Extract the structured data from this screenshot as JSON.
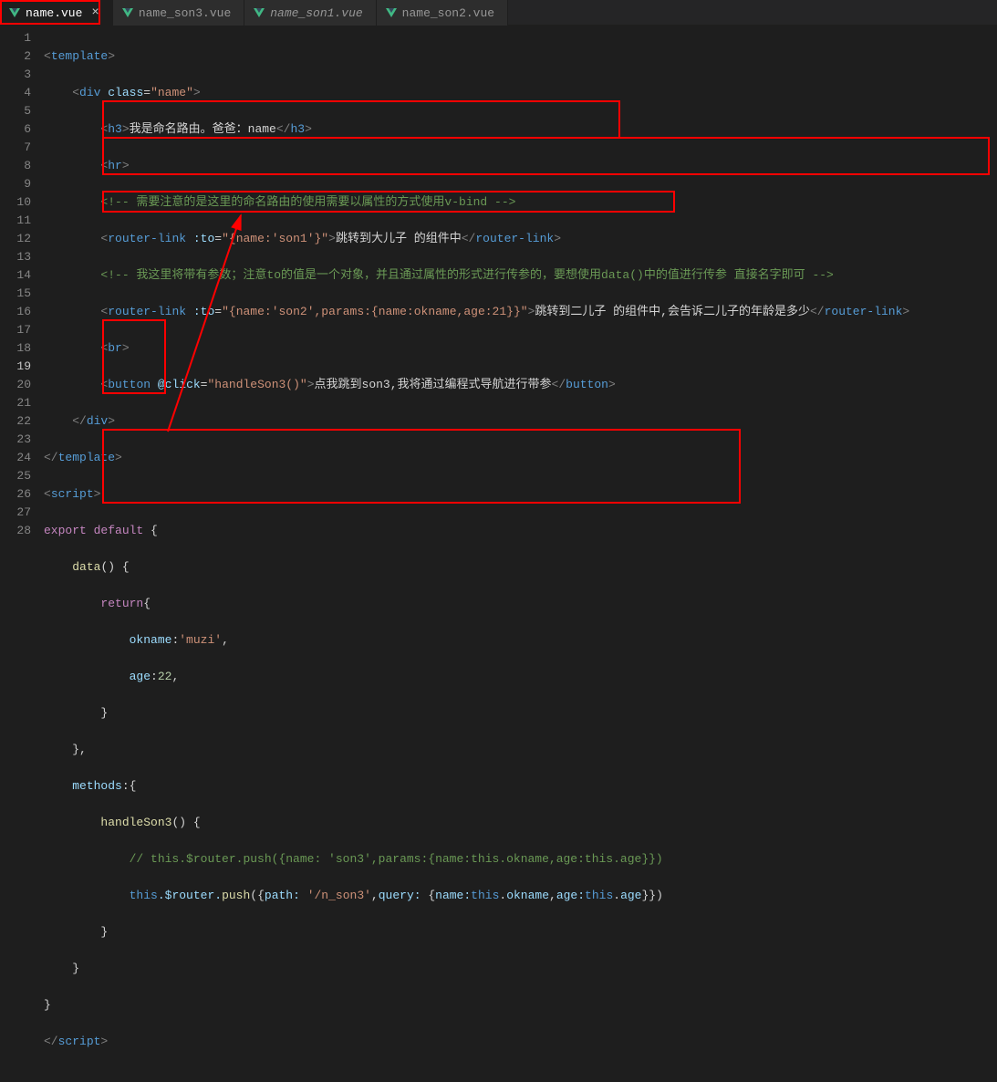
{
  "tabs": [
    {
      "label": "name.vue",
      "active": true,
      "italic": false,
      "closable": true
    },
    {
      "label": "name_son3.vue",
      "active": false,
      "italic": false,
      "closable": false
    },
    {
      "label": "name_son1.vue",
      "active": false,
      "italic": true,
      "closable": false
    },
    {
      "label": "name_son2.vue",
      "active": false,
      "italic": false,
      "closable": false
    }
  ],
  "lineNumbers": [
    "1",
    "2",
    "3",
    "4",
    "5",
    "6",
    "7",
    "8",
    "9",
    "10",
    "11",
    "12",
    "13",
    "14",
    "15",
    "16",
    "17",
    "18",
    "19",
    "20",
    "21",
    "22",
    "23",
    "24",
    "25",
    "26",
    "27",
    "28"
  ],
  "currentLine": "19",
  "code": {
    "l1": {
      "tag": "template"
    },
    "l2": {
      "tag": "div",
      "attr": "class",
      "val": "\"name\""
    },
    "l3": {
      "tag": "h3",
      "text": "我是命名路由。爸爸：name"
    },
    "l4": {
      "tag": "hr"
    },
    "l5": {
      "comment": "<!-- 需要注意的是这里的命名路由的使用需要以属性的方式使用v-bind -->"
    },
    "l6": {
      "tag": "router-link",
      "attr": ":to",
      "val": "\"{name:'son1'}\"",
      "text": "跳转到大儿子 的组件中"
    },
    "l7": {
      "comment": "<!-- 我这里将带有参数；注意to的值是一个对象，并且通过属性的形式进行传参的，要想使用data()中的值进行传参 直接名字即可 -->"
    },
    "l8": {
      "tag": "router-link",
      "attr": ":to",
      "val": "\"{name:'son2',params:{name:okname,age:21}}\"",
      "text": "跳转到二儿子 的组件中,会告诉二儿子的年龄是多少"
    },
    "l9": {
      "tag": "br"
    },
    "l10": {
      "tag": "button",
      "attr": "@click",
      "val": "\"handleSon3()\"",
      "text": "点我跳到son3,我将通过编程式导航进行带参"
    },
    "l11": {
      "close": "div"
    },
    "l12": {
      "close": "template"
    },
    "l13": {
      "tag": "script"
    },
    "l14": {
      "kw": "export default",
      "brace": " {"
    },
    "l15": {
      "fn": "data",
      "sig": "() {"
    },
    "l16": {
      "kw": "return",
      "brace": "{"
    },
    "l17": {
      "key": "okname",
      "val": "'muzi'"
    },
    "l18": {
      "key": "age",
      "val": "22"
    },
    "l19": {
      "brace": "}"
    },
    "l20": {
      "brace": "},"
    },
    "l21": {
      "key": "methods",
      "brace": ":{"
    },
    "l22": {
      "fn": "handleSon3",
      "sig": "() {"
    },
    "l23": {
      "comment": "// this.$router.push({name: 'son3',params:{name:this.okname,age:this.age}})"
    },
    "l24": {
      "this": "this",
      "router": ".$router.",
      "push": "push",
      "path": "path:",
      "pathVal": " '/n_son3'",
      "query": "query:",
      "name": "name:",
      "nameVal": "this.okname",
      "age": "age:",
      "ageVal": "this.age"
    },
    "l25": {
      "brace": "}"
    },
    "l26": {
      "brace": "}"
    },
    "l27": {
      "brace": "}"
    },
    "l28": {
      "close": "script"
    }
  }
}
